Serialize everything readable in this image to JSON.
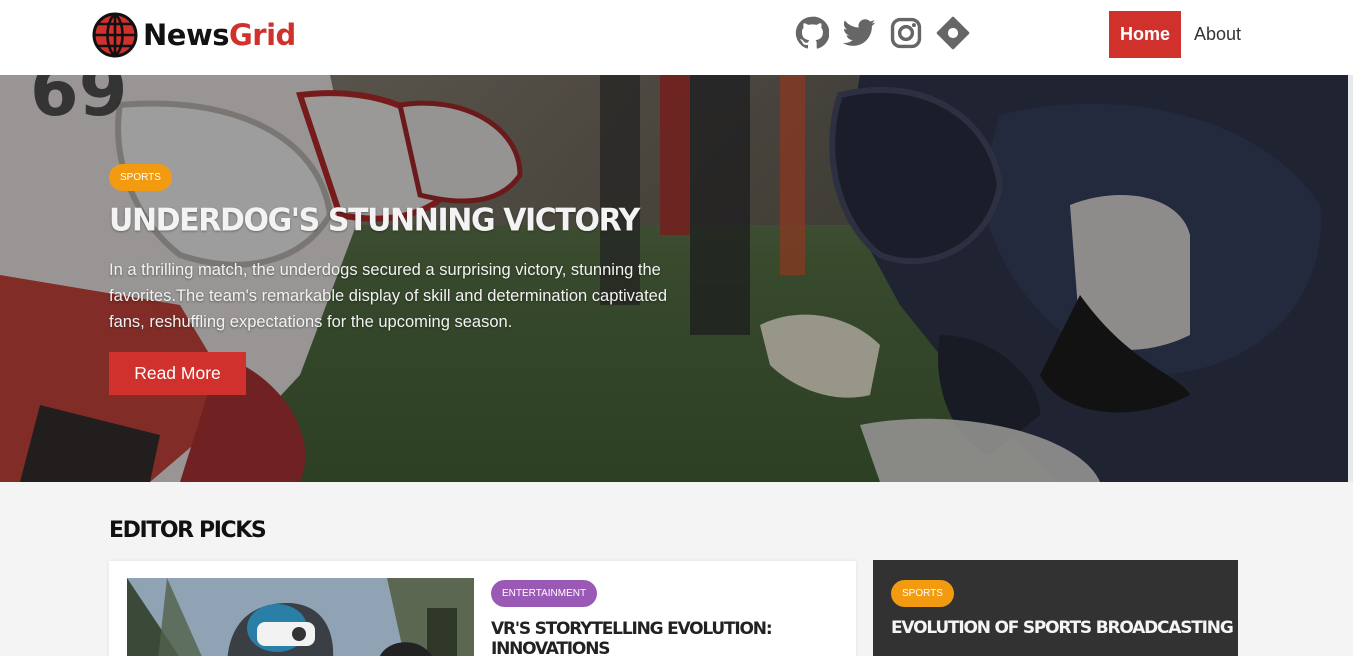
{
  "brand": {
    "name_part1": "News",
    "name_part2": "Grid"
  },
  "social": [
    "github-icon",
    "twitter-icon",
    "instagram-icon",
    "location-icon"
  ],
  "nav": {
    "home": "Home",
    "about": "About"
  },
  "hero": {
    "category": "SPORTS",
    "title": "UNDERDOG'S STUNNING VICTORY",
    "description": "In a thrilling match, the underdogs secured a surprising victory, stunning the favorites.The team's remarkable display of skill and determination captivated fans, reshuffling expectations for the upcoming season.",
    "button": "Read More"
  },
  "editor_picks": {
    "heading": "EDITOR PICKS",
    "featured": {
      "category": "ENTERTAINMENT",
      "title": "VR'S STORYTELLING EVOLUTION: INNOVATIONS"
    },
    "side": {
      "category": "SPORTS",
      "title": "EVOLUTION OF SPORTS BROADCASTING"
    }
  },
  "colors": {
    "accent": "#d0312d",
    "sports_badge": "#f29b11",
    "entertainment_badge": "#9b59b6",
    "dark_card": "#323232"
  }
}
